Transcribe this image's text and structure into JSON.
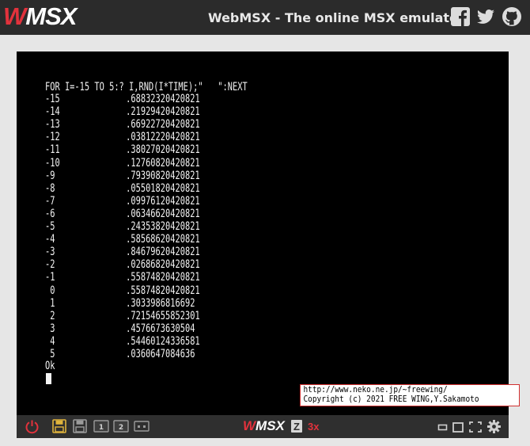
{
  "header": {
    "logo_prefix": "W",
    "logo_text": "MSX",
    "title": "WebMSX - The online MSX emulator",
    "social_icons": [
      "facebook-icon",
      "twitter-icon",
      "github-icon"
    ]
  },
  "screen": {
    "command": "FOR I=-15 TO 5:? I,RND(I*TIME);\"   \":NEXT",
    "rows": [
      {
        "i": "-15",
        "v": ".68832320420821"
      },
      {
        "i": "-14",
        "v": ".21929420420821"
      },
      {
        "i": "-13",
        "v": ".66922720420821"
      },
      {
        "i": "-12",
        "v": ".03812220420821"
      },
      {
        "i": "-11",
        "v": ".38027020420821"
      },
      {
        "i": "-10",
        "v": ".12760820420821"
      },
      {
        "i": "-9",
        "v": ".79390820420821"
      },
      {
        "i": "-8",
        "v": ".05501820420821"
      },
      {
        "i": "-7",
        "v": ".09976120420821"
      },
      {
        "i": "-6",
        "v": ".06346620420821"
      },
      {
        "i": "-5",
        "v": ".24353820420821"
      },
      {
        "i": "-4",
        "v": ".58568620420821"
      },
      {
        "i": "-3",
        "v": ".84679620420821"
      },
      {
        "i": "-2",
        "v": ".02686820420821"
      },
      {
        "i": "-1",
        "v": ".55874820420821"
      },
      {
        "i": " 0",
        "v": ".55874820420821"
      },
      {
        "i": " 1",
        "v": ".3033986816692"
      },
      {
        "i": " 2",
        "v": ".72154655852301"
      },
      {
        "i": " 3",
        "v": ".4576673630504"
      },
      {
        "i": " 4",
        "v": ".54460124336581"
      },
      {
        "i": " 5",
        "v": ".0360647084636"
      }
    ],
    "status": "Ok"
  },
  "copyright": {
    "line1": "http://www.neko.ne.jp/~freewing/",
    "line2": "Copyright (c) 2021 FREE WING,Y.Sakamoto"
  },
  "controls": {
    "brand_prefix": "W",
    "brand_text": "MSX",
    "turbo_letter": "Z",
    "speed": "3x",
    "slot1": "1",
    "slot2": "2",
    "colors": {
      "power": "#e2323c",
      "disk_active": "#e0b43c",
      "icon": "#cfcfcf"
    }
  }
}
